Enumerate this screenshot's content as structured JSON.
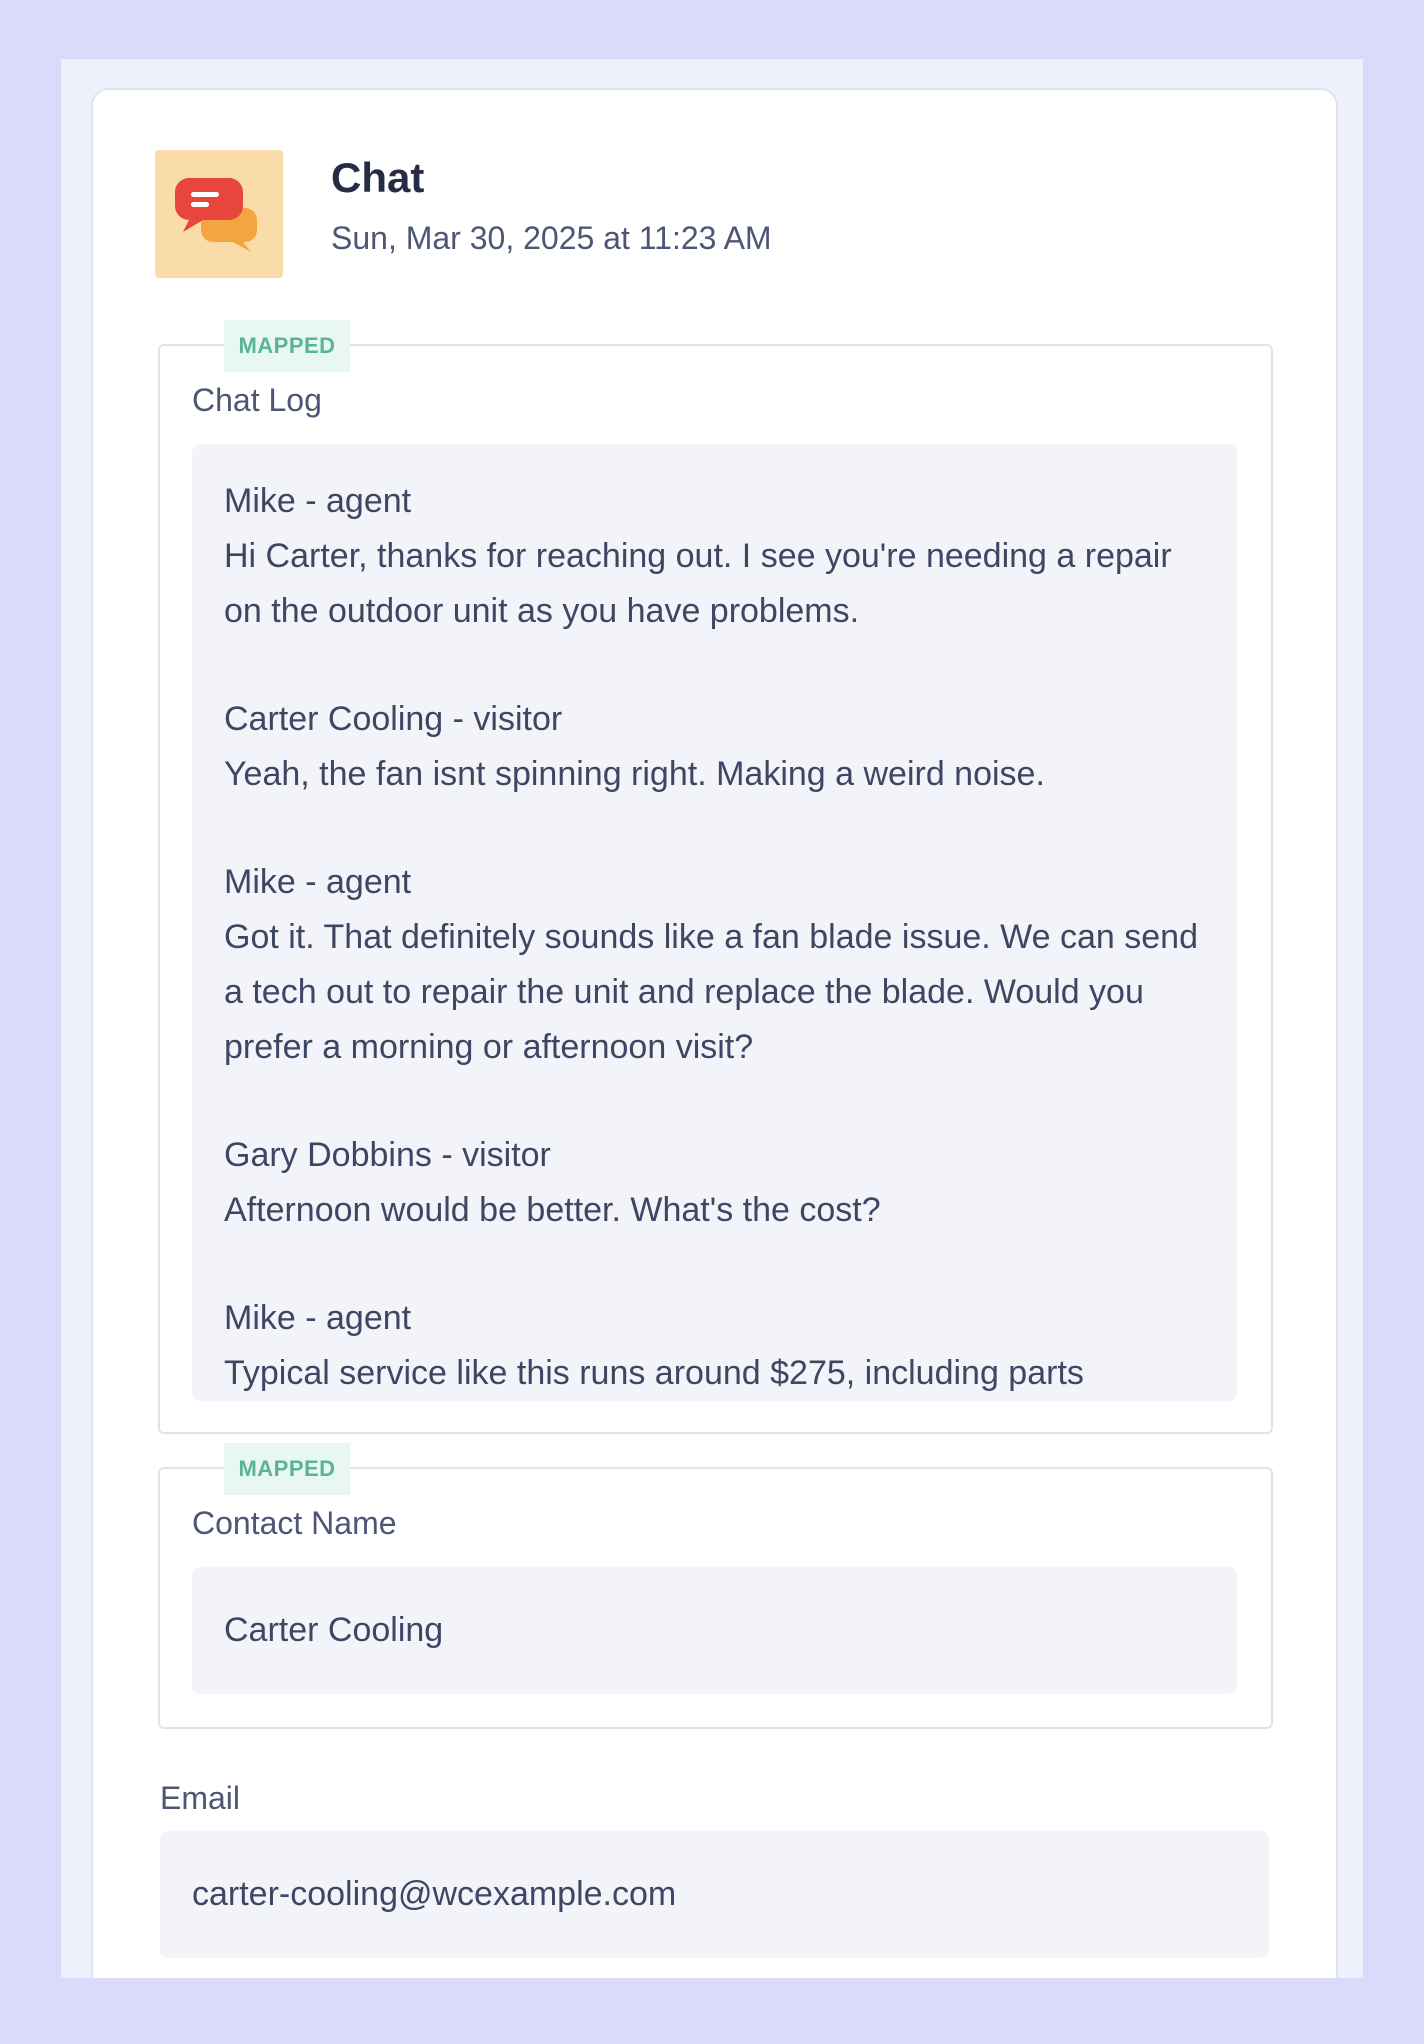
{
  "header": {
    "title": "Chat",
    "timestamp": "Sun, Mar 30, 2025 at 11:23 AM",
    "icon": "chat-bubbles-icon"
  },
  "badge_label": "MAPPED",
  "chat_log": {
    "label": "Chat Log",
    "messages": [
      {
        "sender": "Mike - agent",
        "text": "Hi Carter, thanks for reaching out. I see you're needing a repair on the outdoor unit as you have problems."
      },
      {
        "sender": "Carter Cooling - visitor",
        "text": "Yeah, the fan isnt spinning right. Making a weird noise."
      },
      {
        "sender": "Mike - agent",
        "text": "Got it. That definitely sounds like a fan blade issue. We can send a tech out to repair the unit and replace the blade. Would you prefer a morning or afternoon visit?"
      },
      {
        "sender": "Gary Dobbins - visitor",
        "text": "Afternoon would be better. What's the cost?"
      },
      {
        "sender": "Mike - agent",
        "text": "Typical service like this runs around $275, including parts"
      }
    ]
  },
  "contact_name": {
    "label": "Contact Name",
    "value": "Carter Cooling"
  },
  "email": {
    "label": "Email",
    "value": "carter-cooling@wcexample.com"
  },
  "colors": {
    "background": "#dcdafa",
    "badge_text": "#5bb594",
    "badge_bg": "#e9f7f1",
    "icon_bg": "#fadca8",
    "bubble_red": "#e8453c",
    "bubble_orange": "#f2a540"
  }
}
